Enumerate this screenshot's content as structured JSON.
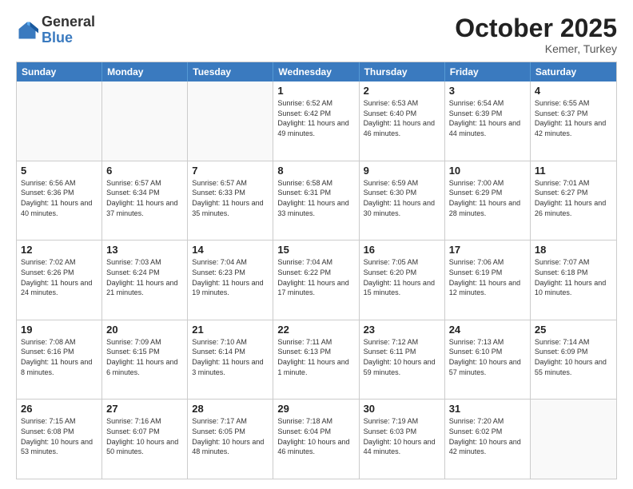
{
  "header": {
    "logo": {
      "line1": "General",
      "line2": "Blue"
    },
    "month": "October 2025",
    "location": "Kemer, Turkey"
  },
  "weekdays": [
    "Sunday",
    "Monday",
    "Tuesday",
    "Wednesday",
    "Thursday",
    "Friday",
    "Saturday"
  ],
  "rows": [
    [
      {
        "day": "",
        "empty": true
      },
      {
        "day": "",
        "empty": true
      },
      {
        "day": "",
        "empty": true
      },
      {
        "day": "1",
        "sunrise": "Sunrise: 6:52 AM",
        "sunset": "Sunset: 6:42 PM",
        "daylight": "Daylight: 11 hours and 49 minutes."
      },
      {
        "day": "2",
        "sunrise": "Sunrise: 6:53 AM",
        "sunset": "Sunset: 6:40 PM",
        "daylight": "Daylight: 11 hours and 46 minutes."
      },
      {
        "day": "3",
        "sunrise": "Sunrise: 6:54 AM",
        "sunset": "Sunset: 6:39 PM",
        "daylight": "Daylight: 11 hours and 44 minutes."
      },
      {
        "day": "4",
        "sunrise": "Sunrise: 6:55 AM",
        "sunset": "Sunset: 6:37 PM",
        "daylight": "Daylight: 11 hours and 42 minutes."
      }
    ],
    [
      {
        "day": "5",
        "sunrise": "Sunrise: 6:56 AM",
        "sunset": "Sunset: 6:36 PM",
        "daylight": "Daylight: 11 hours and 40 minutes."
      },
      {
        "day": "6",
        "sunrise": "Sunrise: 6:57 AM",
        "sunset": "Sunset: 6:34 PM",
        "daylight": "Daylight: 11 hours and 37 minutes."
      },
      {
        "day": "7",
        "sunrise": "Sunrise: 6:57 AM",
        "sunset": "Sunset: 6:33 PM",
        "daylight": "Daylight: 11 hours and 35 minutes."
      },
      {
        "day": "8",
        "sunrise": "Sunrise: 6:58 AM",
        "sunset": "Sunset: 6:31 PM",
        "daylight": "Daylight: 11 hours and 33 minutes."
      },
      {
        "day": "9",
        "sunrise": "Sunrise: 6:59 AM",
        "sunset": "Sunset: 6:30 PM",
        "daylight": "Daylight: 11 hours and 30 minutes."
      },
      {
        "day": "10",
        "sunrise": "Sunrise: 7:00 AM",
        "sunset": "Sunset: 6:29 PM",
        "daylight": "Daylight: 11 hours and 28 minutes."
      },
      {
        "day": "11",
        "sunrise": "Sunrise: 7:01 AM",
        "sunset": "Sunset: 6:27 PM",
        "daylight": "Daylight: 11 hours and 26 minutes."
      }
    ],
    [
      {
        "day": "12",
        "sunrise": "Sunrise: 7:02 AM",
        "sunset": "Sunset: 6:26 PM",
        "daylight": "Daylight: 11 hours and 24 minutes."
      },
      {
        "day": "13",
        "sunrise": "Sunrise: 7:03 AM",
        "sunset": "Sunset: 6:24 PM",
        "daylight": "Daylight: 11 hours and 21 minutes."
      },
      {
        "day": "14",
        "sunrise": "Sunrise: 7:04 AM",
        "sunset": "Sunset: 6:23 PM",
        "daylight": "Daylight: 11 hours and 19 minutes."
      },
      {
        "day": "15",
        "sunrise": "Sunrise: 7:04 AM",
        "sunset": "Sunset: 6:22 PM",
        "daylight": "Daylight: 11 hours and 17 minutes."
      },
      {
        "day": "16",
        "sunrise": "Sunrise: 7:05 AM",
        "sunset": "Sunset: 6:20 PM",
        "daylight": "Daylight: 11 hours and 15 minutes."
      },
      {
        "day": "17",
        "sunrise": "Sunrise: 7:06 AM",
        "sunset": "Sunset: 6:19 PM",
        "daylight": "Daylight: 11 hours and 12 minutes."
      },
      {
        "day": "18",
        "sunrise": "Sunrise: 7:07 AM",
        "sunset": "Sunset: 6:18 PM",
        "daylight": "Daylight: 11 hours and 10 minutes."
      }
    ],
    [
      {
        "day": "19",
        "sunrise": "Sunrise: 7:08 AM",
        "sunset": "Sunset: 6:16 PM",
        "daylight": "Daylight: 11 hours and 8 minutes."
      },
      {
        "day": "20",
        "sunrise": "Sunrise: 7:09 AM",
        "sunset": "Sunset: 6:15 PM",
        "daylight": "Daylight: 11 hours and 6 minutes."
      },
      {
        "day": "21",
        "sunrise": "Sunrise: 7:10 AM",
        "sunset": "Sunset: 6:14 PM",
        "daylight": "Daylight: 11 hours and 3 minutes."
      },
      {
        "day": "22",
        "sunrise": "Sunrise: 7:11 AM",
        "sunset": "Sunset: 6:13 PM",
        "daylight": "Daylight: 11 hours and 1 minute."
      },
      {
        "day": "23",
        "sunrise": "Sunrise: 7:12 AM",
        "sunset": "Sunset: 6:11 PM",
        "daylight": "Daylight: 10 hours and 59 minutes."
      },
      {
        "day": "24",
        "sunrise": "Sunrise: 7:13 AM",
        "sunset": "Sunset: 6:10 PM",
        "daylight": "Daylight: 10 hours and 57 minutes."
      },
      {
        "day": "25",
        "sunrise": "Sunrise: 7:14 AM",
        "sunset": "Sunset: 6:09 PM",
        "daylight": "Daylight: 10 hours and 55 minutes."
      }
    ],
    [
      {
        "day": "26",
        "sunrise": "Sunrise: 7:15 AM",
        "sunset": "Sunset: 6:08 PM",
        "daylight": "Daylight: 10 hours and 53 minutes."
      },
      {
        "day": "27",
        "sunrise": "Sunrise: 7:16 AM",
        "sunset": "Sunset: 6:07 PM",
        "daylight": "Daylight: 10 hours and 50 minutes."
      },
      {
        "day": "28",
        "sunrise": "Sunrise: 7:17 AM",
        "sunset": "Sunset: 6:05 PM",
        "daylight": "Daylight: 10 hours and 48 minutes."
      },
      {
        "day": "29",
        "sunrise": "Sunrise: 7:18 AM",
        "sunset": "Sunset: 6:04 PM",
        "daylight": "Daylight: 10 hours and 46 minutes."
      },
      {
        "day": "30",
        "sunrise": "Sunrise: 7:19 AM",
        "sunset": "Sunset: 6:03 PM",
        "daylight": "Daylight: 10 hours and 44 minutes."
      },
      {
        "day": "31",
        "sunrise": "Sunrise: 7:20 AM",
        "sunset": "Sunset: 6:02 PM",
        "daylight": "Daylight: 10 hours and 42 minutes."
      },
      {
        "day": "",
        "empty": true
      }
    ]
  ]
}
